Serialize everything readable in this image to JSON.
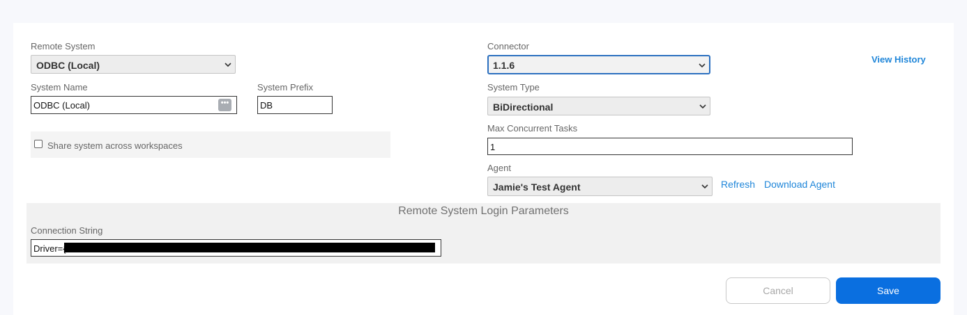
{
  "left": {
    "remote_system": {
      "label": "Remote System",
      "value": "ODBC (Local)"
    },
    "system_name": {
      "label": "System Name",
      "value": "ODBC (Local)",
      "button_icon": "ellipsis-icon",
      "button_glyph": "•••"
    },
    "system_prefix": {
      "label": "System Prefix",
      "value": "DB"
    },
    "share": {
      "label": "Share system across workspaces",
      "checked": false
    }
  },
  "right": {
    "connector": {
      "label": "Connector",
      "value": "1.1.6"
    },
    "view_history": "View History",
    "system_type": {
      "label": "System Type",
      "value": "BiDirectional"
    },
    "max_tasks": {
      "label": "Max Concurrent Tasks",
      "value": "1"
    },
    "agent": {
      "label": "Agent",
      "value": "Jamie's Test Agent",
      "refresh": "Refresh",
      "download": "Download Agent"
    }
  },
  "login_params": {
    "title": "Remote System Login Parameters",
    "connection_string": {
      "label": "Connection String",
      "value": "Driver={"
    }
  },
  "actions": {
    "cancel": "Cancel",
    "save": "Save"
  },
  "colors": {
    "accent": "#0a6fe0",
    "link": "#1f86d9",
    "focus_border": "#2a6fbf"
  }
}
